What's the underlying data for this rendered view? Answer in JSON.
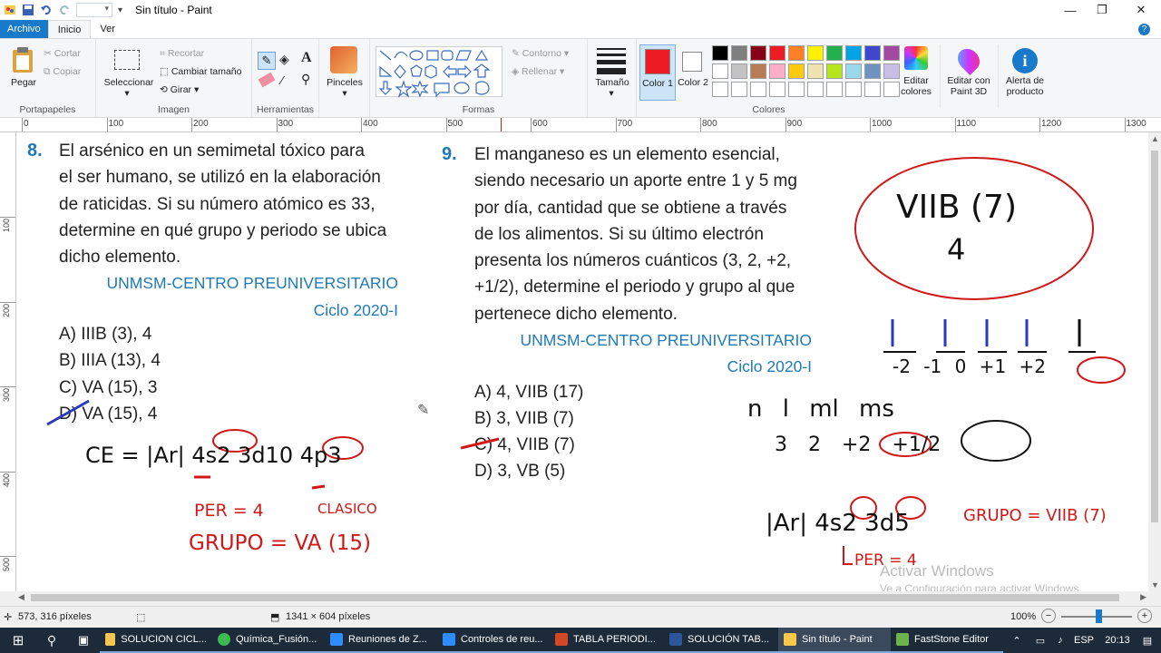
{
  "window": {
    "title": "Sin título - Paint",
    "controls": [
      "—",
      "❐",
      "✕"
    ]
  },
  "ribbon_tabs": [
    "Archivo",
    "Inicio",
    "Ver"
  ],
  "ribbon": {
    "clipboard": {
      "paste": "Pegar",
      "cut": "Cortar",
      "copy": "Copiar",
      "label": "Portapapeles"
    },
    "image": {
      "select": "Seleccionar",
      "crop": "Recortar",
      "resize": "Cambiar tamaño",
      "rotate": "Girar",
      "label": "Imagen"
    },
    "tools": {
      "label": "Herramientas"
    },
    "brushes": {
      "label": "Pinceles"
    },
    "shapes": {
      "outline": "Contorno",
      "fill": "Rellenar",
      "label": "Formas"
    },
    "size": {
      "label": "Tamaño"
    },
    "color1": "Color 1",
    "color2": "Color 2",
    "colors_label": "Colores",
    "edit_colors": "Editar colores",
    "paint3d": "Editar con Paint 3D",
    "alert": "Alerta de producto",
    "palette": [
      "#000000",
      "#7f7f7f",
      "#880015",
      "#ed1c24",
      "#ff7f27",
      "#fff200",
      "#22b14c",
      "#00a2e8",
      "#3f48cc",
      "#a349a4",
      "#ffffff",
      "#c3c3c3",
      "#b97a57",
      "#ffaec9",
      "#ffc90e",
      "#efe4b0",
      "#b5e61d",
      "#99d9ea",
      "#7092be",
      "#c8bfe7"
    ],
    "color1_value": "#ed1c24",
    "color2_value": "#ffffff"
  },
  "ruler": {
    "h_ticks": [
      "0",
      "100",
      "200",
      "300",
      "400",
      "500",
      "600",
      "700",
      "800",
      "900",
      "1000",
      "1100",
      "1200",
      "1300"
    ],
    "v_ticks": [
      "100",
      "200",
      "300",
      "400",
      "500"
    ]
  },
  "q8": {
    "number": "8.",
    "lines": [
      "El arsénico en un semimetal tóxico para",
      "el ser humano, se utilizó en la elaboración",
      "de raticidas. Si su número atómico es 33,",
      "determine en qué grupo y periodo se ubica",
      "dicho elemento."
    ],
    "source": "UNMSM-CENTRO PREUNIVERSITARIO",
    "cycle": "Ciclo 2020-I",
    "options": [
      "A)   IIIB (3), 4",
      "B)   IIIA (13), 4",
      "C)   VA (15), 3",
      "D)   VA (15), 4"
    ]
  },
  "q9": {
    "number": "9.",
    "lines": [
      "El manganeso es un elemento esencial,",
      "siendo necesario un aporte entre 1 y 5 mg",
      "por día, cantidad que se obtiene a través",
      "de los alimentos. Si su último electrón",
      "presenta los números cuánticos (3, 2, +2,",
      "+1/2), determine el periodo y grupo al que",
      "pertenece dicho elemento."
    ],
    "source": "UNMSM-CENTRO PREUNIVERSITARIO",
    "cycle": "Ciclo 2020-I",
    "options": [
      "A)   4, VIIB (17)",
      "B)   3, VIIB (7)",
      "C)   4, VIIB (7)",
      "D)   3, VB (5)"
    ]
  },
  "annotations": {
    "ce8": "CE = |Ar| 4s2 3d10 4p3",
    "per8": "PER = 4",
    "clasico": "CLASICO",
    "grupo8": "GRUPO = VA (15)",
    "circle_top": "VIIB (7)",
    "circle_bottom": "4",
    "ml": "-2  -1  0  +1  +2",
    "qn_labels": "n   l   ml   ms",
    "qn_values": "3   2   +2   +1/2",
    "ce9": "|Ar| 4s2 3d5",
    "per9": "PER = 4",
    "grupo9": "GRUPO = VIIB (7)"
  },
  "watermark": {
    "title": "Activar Windows",
    "sub": "Ve a Configuración para activar Windows."
  },
  "status": {
    "cursor": "573, 316 píxeles",
    "size": "1341 × 604 píxeles",
    "zoom": "100%"
  },
  "taskbar": {
    "items": [
      "SOLUCION CICL...",
      "Química_Fusión...",
      "Reuniones de Z...",
      "Controles de reu...",
      "TABLA PERIODI...",
      "SOLUCIÓN TAB...",
      "Sin título - Paint",
      "FastStone Editor"
    ],
    "lang": "ESP",
    "time": "20:13"
  }
}
